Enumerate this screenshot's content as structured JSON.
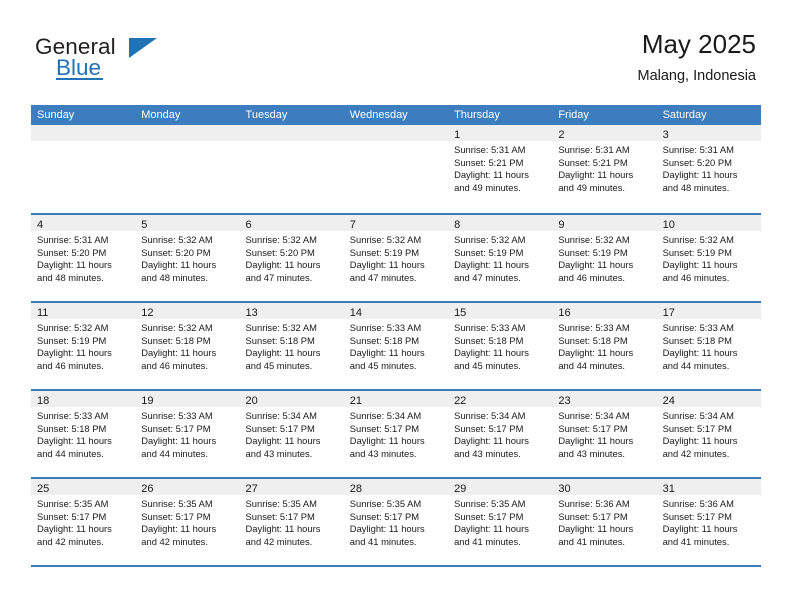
{
  "brand": {
    "name_top": "General",
    "name_bottom": "Blue"
  },
  "header": {
    "title": "May 2025",
    "subtitle": "Malang, Indonesia"
  },
  "calendar": {
    "weekday_headers": [
      "Sunday",
      "Monday",
      "Tuesday",
      "Wednesday",
      "Thursday",
      "Friday",
      "Saturday"
    ],
    "accent_color": "#3b7dbf",
    "daynum_band_color": "#efefef",
    "weeks": [
      [
        {
          "day": "",
          "lines": []
        },
        {
          "day": "",
          "lines": []
        },
        {
          "day": "",
          "lines": []
        },
        {
          "day": "",
          "lines": []
        },
        {
          "day": "1",
          "lines": [
            "Sunrise: 5:31 AM",
            "Sunset: 5:21 PM",
            "Daylight: 11 hours",
            "and 49 minutes."
          ]
        },
        {
          "day": "2",
          "lines": [
            "Sunrise: 5:31 AM",
            "Sunset: 5:21 PM",
            "Daylight: 11 hours",
            "and 49 minutes."
          ]
        },
        {
          "day": "3",
          "lines": [
            "Sunrise: 5:31 AM",
            "Sunset: 5:20 PM",
            "Daylight: 11 hours",
            "and 48 minutes."
          ]
        }
      ],
      [
        {
          "day": "4",
          "lines": [
            "Sunrise: 5:31 AM",
            "Sunset: 5:20 PM",
            "Daylight: 11 hours",
            "and 48 minutes."
          ]
        },
        {
          "day": "5",
          "lines": [
            "Sunrise: 5:32 AM",
            "Sunset: 5:20 PM",
            "Daylight: 11 hours",
            "and 48 minutes."
          ]
        },
        {
          "day": "6",
          "lines": [
            "Sunrise: 5:32 AM",
            "Sunset: 5:20 PM",
            "Daylight: 11 hours",
            "and 47 minutes."
          ]
        },
        {
          "day": "7",
          "lines": [
            "Sunrise: 5:32 AM",
            "Sunset: 5:19 PM",
            "Daylight: 11 hours",
            "and 47 minutes."
          ]
        },
        {
          "day": "8",
          "lines": [
            "Sunrise: 5:32 AM",
            "Sunset: 5:19 PM",
            "Daylight: 11 hours",
            "and 47 minutes."
          ]
        },
        {
          "day": "9",
          "lines": [
            "Sunrise: 5:32 AM",
            "Sunset: 5:19 PM",
            "Daylight: 11 hours",
            "and 46 minutes."
          ]
        },
        {
          "day": "10",
          "lines": [
            "Sunrise: 5:32 AM",
            "Sunset: 5:19 PM",
            "Daylight: 11 hours",
            "and 46 minutes."
          ]
        }
      ],
      [
        {
          "day": "11",
          "lines": [
            "Sunrise: 5:32 AM",
            "Sunset: 5:19 PM",
            "Daylight: 11 hours",
            "and 46 minutes."
          ]
        },
        {
          "day": "12",
          "lines": [
            "Sunrise: 5:32 AM",
            "Sunset: 5:18 PM",
            "Daylight: 11 hours",
            "and 46 minutes."
          ]
        },
        {
          "day": "13",
          "lines": [
            "Sunrise: 5:32 AM",
            "Sunset: 5:18 PM",
            "Daylight: 11 hours",
            "and 45 minutes."
          ]
        },
        {
          "day": "14",
          "lines": [
            "Sunrise: 5:33 AM",
            "Sunset: 5:18 PM",
            "Daylight: 11 hours",
            "and 45 minutes."
          ]
        },
        {
          "day": "15",
          "lines": [
            "Sunrise: 5:33 AM",
            "Sunset: 5:18 PM",
            "Daylight: 11 hours",
            "and 45 minutes."
          ]
        },
        {
          "day": "16",
          "lines": [
            "Sunrise: 5:33 AM",
            "Sunset: 5:18 PM",
            "Daylight: 11 hours",
            "and 44 minutes."
          ]
        },
        {
          "day": "17",
          "lines": [
            "Sunrise: 5:33 AM",
            "Sunset: 5:18 PM",
            "Daylight: 11 hours",
            "and 44 minutes."
          ]
        }
      ],
      [
        {
          "day": "18",
          "lines": [
            "Sunrise: 5:33 AM",
            "Sunset: 5:18 PM",
            "Daylight: 11 hours",
            "and 44 minutes."
          ]
        },
        {
          "day": "19",
          "lines": [
            "Sunrise: 5:33 AM",
            "Sunset: 5:17 PM",
            "Daylight: 11 hours",
            "and 44 minutes."
          ]
        },
        {
          "day": "20",
          "lines": [
            "Sunrise: 5:34 AM",
            "Sunset: 5:17 PM",
            "Daylight: 11 hours",
            "and 43 minutes."
          ]
        },
        {
          "day": "21",
          "lines": [
            "Sunrise: 5:34 AM",
            "Sunset: 5:17 PM",
            "Daylight: 11 hours",
            "and 43 minutes."
          ]
        },
        {
          "day": "22",
          "lines": [
            "Sunrise: 5:34 AM",
            "Sunset: 5:17 PM",
            "Daylight: 11 hours",
            "and 43 minutes."
          ]
        },
        {
          "day": "23",
          "lines": [
            "Sunrise: 5:34 AM",
            "Sunset: 5:17 PM",
            "Daylight: 11 hours",
            "and 43 minutes."
          ]
        },
        {
          "day": "24",
          "lines": [
            "Sunrise: 5:34 AM",
            "Sunset: 5:17 PM",
            "Daylight: 11 hours",
            "and 42 minutes."
          ]
        }
      ],
      [
        {
          "day": "25",
          "lines": [
            "Sunrise: 5:35 AM",
            "Sunset: 5:17 PM",
            "Daylight: 11 hours",
            "and 42 minutes."
          ]
        },
        {
          "day": "26",
          "lines": [
            "Sunrise: 5:35 AM",
            "Sunset: 5:17 PM",
            "Daylight: 11 hours",
            "and 42 minutes."
          ]
        },
        {
          "day": "27",
          "lines": [
            "Sunrise: 5:35 AM",
            "Sunset: 5:17 PM",
            "Daylight: 11 hours",
            "and 42 minutes."
          ]
        },
        {
          "day": "28",
          "lines": [
            "Sunrise: 5:35 AM",
            "Sunset: 5:17 PM",
            "Daylight: 11 hours",
            "and 41 minutes."
          ]
        },
        {
          "day": "29",
          "lines": [
            "Sunrise: 5:35 AM",
            "Sunset: 5:17 PM",
            "Daylight: 11 hours",
            "and 41 minutes."
          ]
        },
        {
          "day": "30",
          "lines": [
            "Sunrise: 5:36 AM",
            "Sunset: 5:17 PM",
            "Daylight: 11 hours",
            "and 41 minutes."
          ]
        },
        {
          "day": "31",
          "lines": [
            "Sunrise: 5:36 AM",
            "Sunset: 5:17 PM",
            "Daylight: 11 hours",
            "and 41 minutes."
          ]
        }
      ]
    ]
  }
}
